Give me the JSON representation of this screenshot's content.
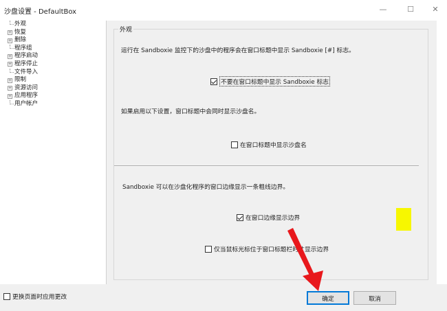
{
  "window": {
    "title": "沙盘设置 - DefaultBox",
    "minimize_glyph": "—",
    "maximize_glyph": "☐",
    "close_glyph": "✕"
  },
  "tree": {
    "items": [
      {
        "label": "外观",
        "expander": ""
      },
      {
        "label": "恢复",
        "expander": "+"
      },
      {
        "label": "删除",
        "expander": "+"
      },
      {
        "label": "程序组",
        "expander": ""
      },
      {
        "label": "程序启动",
        "expander": "+"
      },
      {
        "label": "程序停止",
        "expander": "+"
      },
      {
        "label": "文件导入",
        "expander": ""
      },
      {
        "label": "限制",
        "expander": "+"
      },
      {
        "label": "资源访问",
        "expander": "+"
      },
      {
        "label": "应用程序",
        "expander": "+"
      },
      {
        "label": "用户帐户",
        "expander": ""
      }
    ]
  },
  "appearance": {
    "group_title": "外观",
    "intro_text": "运行在 Sandboxie 监控下的沙盘中的程序会在窗口标题中显示 Sandboxie [#] 标志。",
    "chk_no_indicator": {
      "label": "不要在窗口标题中显示 Sandboxie 标志",
      "checked": true
    },
    "name_text": "如果启用以下设置，窗口标题中会同时显示沙盘名。",
    "chk_show_name": {
      "label": "在窗口标题中显示沙盘名",
      "checked": false
    },
    "border_text": "Sandboxie 可以在沙盘化程序的窗口边缘显示一条粗线边界。",
    "chk_show_border": {
      "label": "在窗口边缘显示边界",
      "checked": true
    },
    "chk_border_on_hover": {
      "label": "仅当鼠标光标位于窗口标题栏时才显示边界",
      "checked": false
    }
  },
  "footer": {
    "chk_apply_on_switch": {
      "label": "更换页面时应用更改",
      "checked": false
    },
    "ok_label": "确定",
    "cancel_label": "取消"
  },
  "colors": {
    "highlight": "#f7f700",
    "arrow": "#e8181c",
    "ok_border": "#0078d7"
  }
}
